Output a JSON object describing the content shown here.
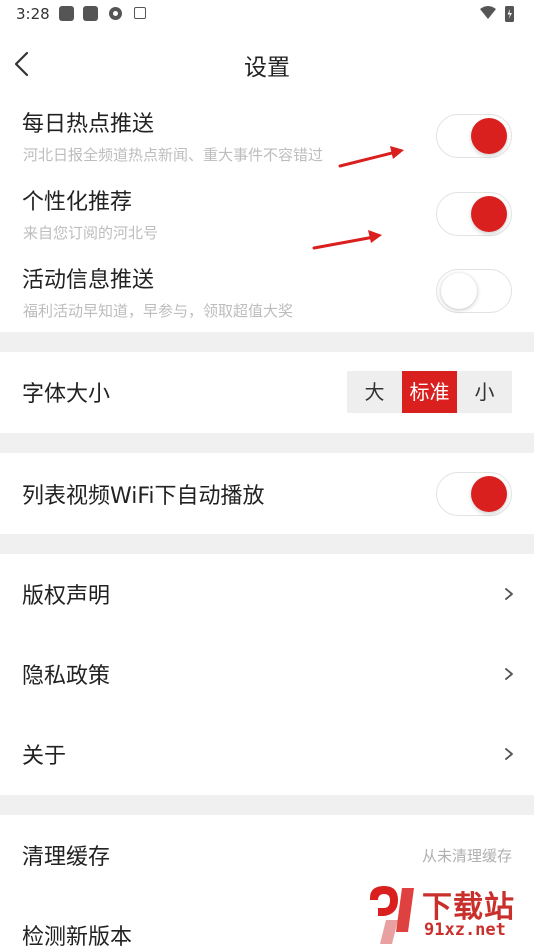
{
  "status_bar": {
    "time": "3:28"
  },
  "header": {
    "title": "设置"
  },
  "push": {
    "daily_hot": {
      "title": "每日热点推送",
      "subtitle": "河北日报全频道热点新闻、重大事件不容错过",
      "enabled": true
    },
    "personalized": {
      "title": "个性化推荐",
      "subtitle": "来自您订阅的河北号",
      "enabled": true
    },
    "activity": {
      "title": "活动信息推送",
      "subtitle": "福利活动早知道，早参与，领取超值大奖",
      "enabled": false
    }
  },
  "font_size": {
    "title": "字体大小",
    "options": [
      "大",
      "标准",
      "小"
    ],
    "selected": "标准"
  },
  "video": {
    "title": "列表视频WiFi下自动播放",
    "enabled": true
  },
  "links": {
    "copyright": "版权声明",
    "privacy": "隐私政策",
    "about": "关于"
  },
  "cache": {
    "title": "清理缓存",
    "value": "从未清理缓存"
  },
  "update": {
    "title": "检测新版本"
  },
  "watermark": {
    "title": "下载站",
    "url": "91xz.net"
  },
  "colors": {
    "accent": "#d9201e",
    "divider": "#f0f0f0",
    "subtitle": "#bdbdbd"
  }
}
